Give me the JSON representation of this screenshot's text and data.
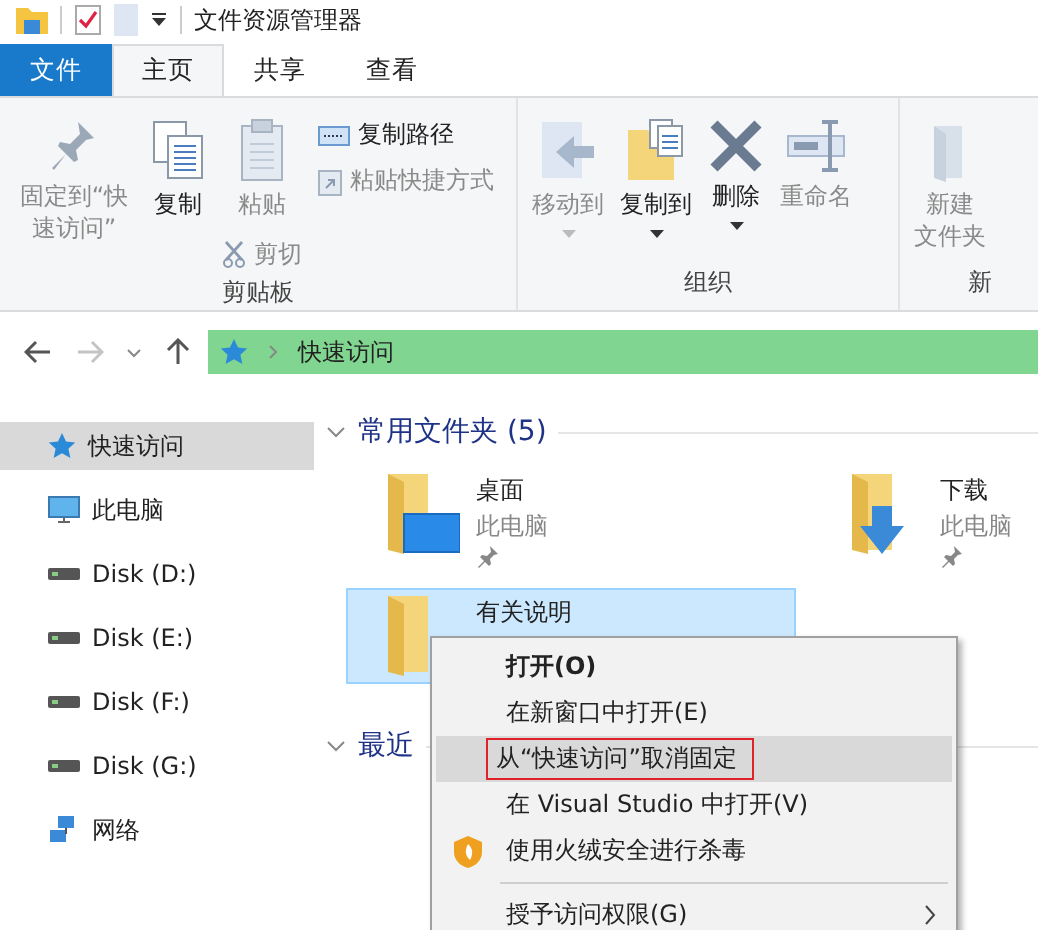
{
  "window": {
    "title": "文件资源管理器"
  },
  "tabs": [
    {
      "label": "文件",
      "kind": "file",
      "selected": false
    },
    {
      "label": "主页",
      "kind": "tab",
      "selected": true
    },
    {
      "label": "共享",
      "kind": "tab",
      "selected": false
    },
    {
      "label": "查看",
      "kind": "tab",
      "selected": false
    }
  ],
  "ribbon": {
    "groups": [
      {
        "label": "剪贴板",
        "kind": "clipboard",
        "items": [
          {
            "label": "固定到“快速访问”",
            "kind": "pin",
            "disabled": true
          },
          {
            "label": "复制",
            "kind": "copy",
            "disabled": false
          },
          {
            "label": "粘贴",
            "kind": "paste",
            "disabled": true
          },
          {
            "label": "剪切",
            "kind": "cut",
            "disabled": true
          },
          {
            "label": "复制路径",
            "kind": "copypath",
            "disabled": false
          },
          {
            "label": "粘贴快捷方式",
            "kind": "pasteshortcut",
            "disabled": true
          }
        ]
      },
      {
        "label": "组织",
        "kind": "organize",
        "items": [
          {
            "label": "移动到",
            "kind": "moveto",
            "disabled": true
          },
          {
            "label": "复制到",
            "kind": "copyto",
            "disabled": false
          },
          {
            "label": "删除",
            "kind": "delete",
            "disabled": false
          },
          {
            "label": "重命名",
            "kind": "rename",
            "disabled": true
          }
        ]
      },
      {
        "label": "新",
        "kind": "new",
        "items": [
          {
            "lines": [
              "新建",
              "文件夹"
            ],
            "kind": "newfolder",
            "disabled": true
          }
        ]
      }
    ]
  },
  "address": {
    "location": "快速访问"
  },
  "sidebar": {
    "items": [
      {
        "label": "快速访问",
        "kind": "quick",
        "selected": true
      },
      {
        "label": "此电脑",
        "kind": "pc",
        "selected": false
      },
      {
        "label": "Disk (D:)",
        "kind": "disk",
        "selected": false
      },
      {
        "label": "Disk (E:)",
        "kind": "disk",
        "selected": false
      },
      {
        "label": "Disk (F:)",
        "kind": "disk",
        "selected": false
      },
      {
        "label": "Disk (G:)",
        "kind": "disk",
        "selected": false
      },
      {
        "label": "网络",
        "kind": "network",
        "selected": false
      }
    ]
  },
  "sections": [
    {
      "title": "常用文件夹 (5)",
      "expanded": true
    },
    {
      "title": "最近",
      "expanded": true
    }
  ],
  "folders": [
    {
      "name": "桌面",
      "location": "此电脑",
      "kind": "desktop",
      "pinned": true,
      "selected": false
    },
    {
      "name": "下载",
      "location": "此电脑",
      "kind": "download",
      "pinned": true,
      "selected": false
    },
    {
      "name": "有关说明",
      "kind": "plain",
      "pinned": false,
      "selected": true
    }
  ],
  "context_menu": {
    "items": [
      {
        "label": "打开(O)",
        "default": true,
        "selected": false,
        "outlined": false
      },
      {
        "label": "在新窗口中打开(E)",
        "default": false,
        "selected": false,
        "outlined": false
      },
      {
        "label": "从“快速访问”取消固定",
        "default": false,
        "selected": true,
        "outlined": true
      },
      {
        "label": "在 Visual Studio 中打开(V)",
        "default": false,
        "selected": false,
        "outlined": false
      },
      {
        "label": "使用火绒安全进行杀毒",
        "kind": "antivirus",
        "default": false,
        "selected": false,
        "outlined": false
      },
      {
        "kind": "separator"
      },
      {
        "label": "授予访问权限(G)",
        "default": false,
        "selected": false,
        "outlined": false,
        "submenu": true
      }
    ]
  }
}
